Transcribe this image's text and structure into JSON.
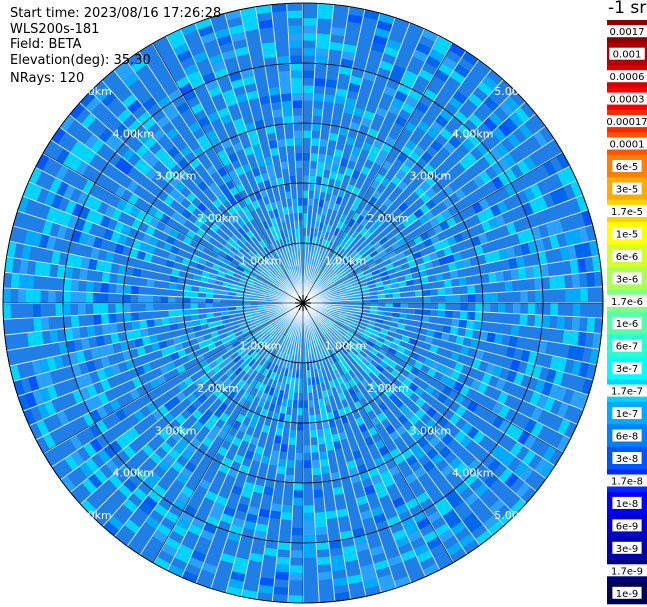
{
  "info": {
    "start_time": "Start time: 2023/08/16 17:26:28",
    "instrument": "WLS200s-181",
    "field": "Field: BETA",
    "elevation": "Elevation(deg): 35.30",
    "nrays": "NRays: 120"
  },
  "chart_data": {
    "type": "heatmap",
    "projection": "polar-ppi",
    "rays": 120,
    "max_range_km": 5.0,
    "range_ring_labels": [
      "1.00km",
      "2.00km",
      "3.00km",
      "4.00km",
      "5.00km"
    ],
    "range_ring_values_km": [
      1,
      2,
      3,
      4,
      5
    ],
    "colorbar": {
      "title": "-1 sr",
      "labels": [
        "0.0017",
        "0.001",
        "0.0006",
        "0.0003",
        "0.00017",
        "0.0001",
        "6e-5",
        "3e-5",
        "1.7e-5",
        "1e-5",
        "6e-6",
        "3e-6",
        "1.7e-6",
        "1e-6",
        "6e-7",
        "3e-7",
        "1.7e-7",
        "1e-7",
        "6e-8",
        "3e-8",
        "1.7e-8",
        "1e-8",
        "6e-9",
        "3e-9",
        "1.7e-9",
        "1e-9"
      ],
      "colors": [
        "#8b0000",
        "#b00000",
        "#d80000",
        "#ff0000",
        "#ff2a00",
        "#ff5500",
        "#ff8000",
        "#ffaa00",
        "#ffd400",
        "#ffff00",
        "#d4ff2a",
        "#aaff55",
        "#80ff80",
        "#55ffaa",
        "#2affd4",
        "#00ffff",
        "#00d4ff",
        "#00aaff",
        "#0080ff",
        "#0055ff",
        "#002aff",
        "#0000ff",
        "#0000d4",
        "#0000aa",
        "#00007f",
        "#000050"
      ]
    },
    "dominant_value_range": [
      "1.7e-8",
      "1e-7"
    ],
    "legend_position": "right"
  }
}
